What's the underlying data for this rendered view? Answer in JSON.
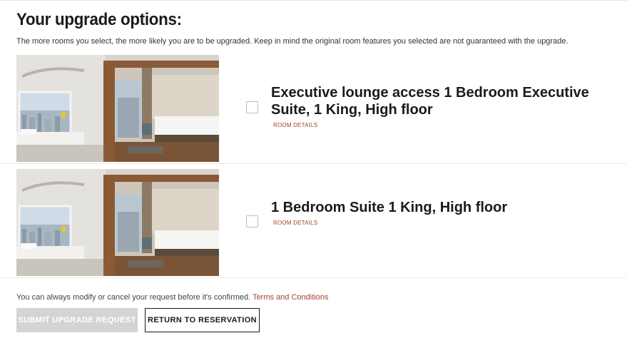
{
  "heading": "Your upgrade options:",
  "intro": "The more rooms you select, the more likely you are to be upgraded. Keep in mind the original room features you selected are not guaranteed with the upgrade.",
  "options": [
    {
      "title": "Executive lounge access 1 Bedroom Executive Suite, 1 King, High floor",
      "details_link": "ROOM DETAILS",
      "selected": false
    },
    {
      "title": "1 Bedroom Suite 1 King, High floor",
      "details_link": "ROOM DETAILS",
      "selected": false
    }
  ],
  "footer": {
    "note": "You can always modify or cancel your request before it's confirmed.",
    "terms_link": "Terms and Conditions"
  },
  "buttons": {
    "submit": "SUBMIT UPGRADE REQUEST",
    "return": "RETURN TO RESERVATION"
  },
  "colors": {
    "accent_link": "#a0432f",
    "disabled_button": "#d4d4d4"
  }
}
